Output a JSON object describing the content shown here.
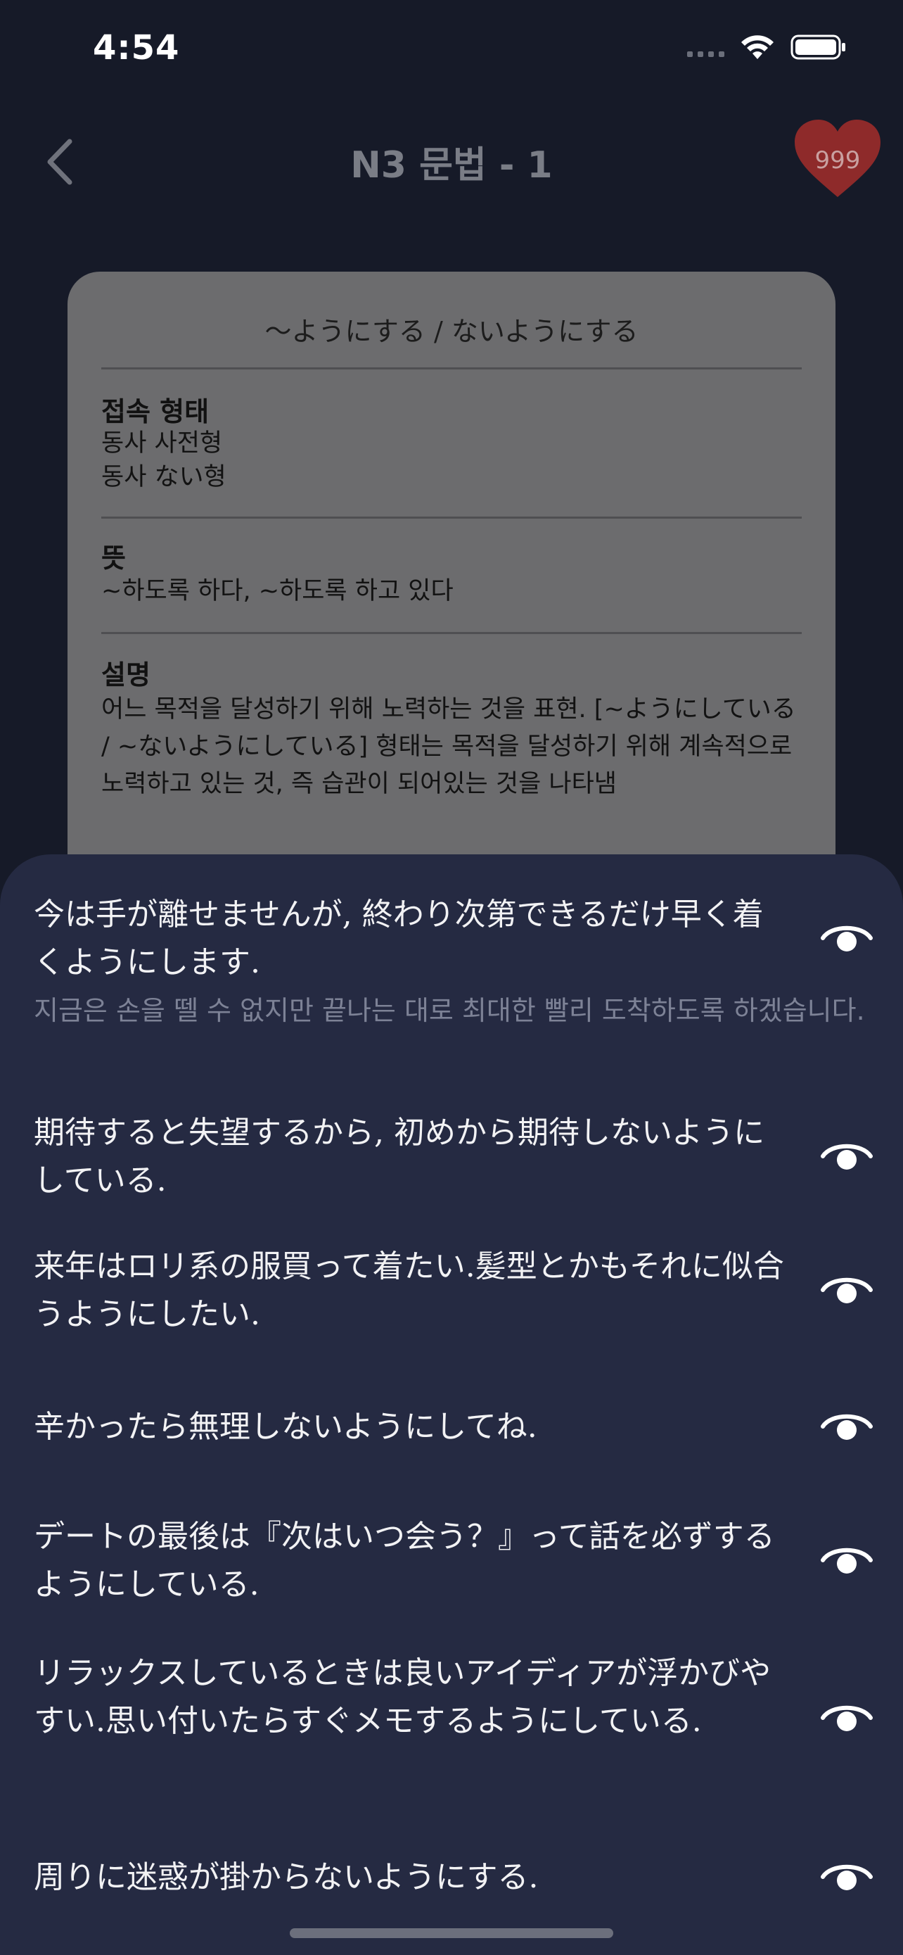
{
  "status_bar": {
    "time": "4:54",
    "icons": [
      "cellular-signal-icon",
      "wifi-icon",
      "battery-icon"
    ]
  },
  "nav": {
    "title": "N3 문법 - 1",
    "back_icon": "chevron-left-icon",
    "heart_count": "999",
    "heart_color": "#8e2a2a"
  },
  "card": {
    "title": "〜ようにする / ないようにする",
    "connection": {
      "heading": "접속 형태",
      "lines": [
        "동사 사전형",
        "동사 ない형"
      ]
    },
    "meaning": {
      "heading": "뜻",
      "text": "~하도록 하다, ~하도록 하고 있다"
    },
    "explanation": {
      "heading": "설명",
      "text": "어느 목적을 달성하기 위해 노력하는 것을 표현. [~ようにしている / ~ないようにしている] 형태는 목적을 달성하기 위해 계속적으로 노력하고 있는 것, 즉 습관이 되어있는 것을 나타냄"
    }
  },
  "sentences": [
    {
      "jp": "今は手が離せませんが, 終わり次第できるだけ早く着くようにします.",
      "kr": "지금은 손을 뗄 수 없지만 끝나는 대로 최대한 빨리 도착하도록 하겠습니다."
    },
    {
      "jp": "期待すると失望するから, 初めから期待しないようにしている."
    },
    {
      "jp": "来年はロリ系の服買って着たい.髪型とかもそれに似合うようにしたい."
    },
    {
      "jp": "辛かったら無理しないようにしてね."
    },
    {
      "jp": "デートの最後は『次はいつ会う？』って話を必ずするようにしている."
    },
    {
      "jp": "リラックスしているときは良いアイディアが浮かびやすい.思い付いたらすぐメモするようにしている."
    },
    {
      "jp": "周りに迷惑が掛からないようにする."
    }
  ],
  "colors": {
    "background": "#161a28",
    "sheet": "#252a42",
    "card": "#6c6c6e"
  }
}
